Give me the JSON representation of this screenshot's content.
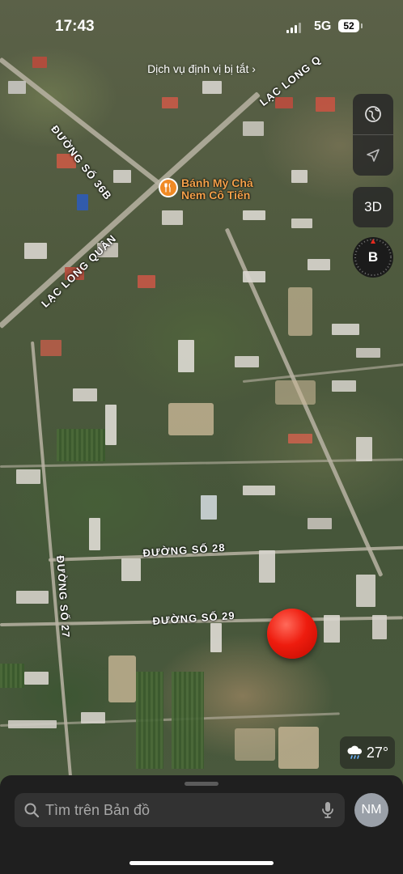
{
  "status_bar": {
    "time": "17:43",
    "network": "5G",
    "battery": "52"
  },
  "location_services_notice": "Dịch vụ định vị bị tắt",
  "map_controls": {
    "map_mode_icon": "globe-icon",
    "location_icon": "location-arrow-icon",
    "three_d_label": "3D",
    "compass_label": "B"
  },
  "streets": [
    {
      "label": "LẠC LONG QUÂN"
    },
    {
      "label": "ĐƯỜNG SỐ 36B"
    },
    {
      "label": "LẠC LONG Q"
    },
    {
      "label": "ĐƯỜNG SỐ 28"
    },
    {
      "label": "ĐƯỜNG SỐ 29"
    },
    {
      "label": "ĐƯỜNG SỐ 27"
    }
  ],
  "poi": {
    "name_line1": "Bánh Mỳ Chả",
    "name_line2": "Nem Cô Tiến",
    "icon": "fork-knife-icon",
    "color": "#f08a24"
  },
  "weather": {
    "icon": "cloud-rain-icon",
    "temperature": "27°"
  },
  "search": {
    "placeholder": "Tìm trên Bản đồ"
  },
  "user": {
    "initials": "NM"
  },
  "marker_color": "#ee1c0e"
}
